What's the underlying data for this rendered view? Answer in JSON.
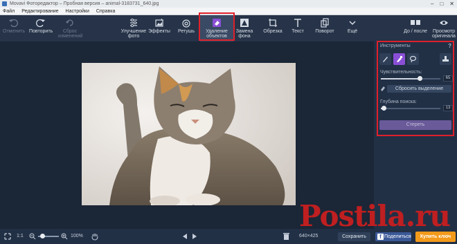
{
  "titlebar": {
    "title": "Movavi Фоторедактор – Пробная версия – animal-3183731_640.jpg",
    "controls": [
      "–",
      "□",
      "✕"
    ]
  },
  "menu": [
    "Файл",
    "Редактирование",
    "Настройки",
    "Справка"
  ],
  "toolbar": {
    "undo": "Отменить",
    "redo": "Повторить",
    "reset_line1": "Сброс",
    "reset_line2": "изменений",
    "enhance_line1": "Улучшение",
    "enhance_line2": "фото",
    "effects": "Эффекты",
    "retouch": "Ретушь",
    "remove_line1": "Удаление",
    "remove_line2": "объектов",
    "bg_line1": "Замена",
    "bg_line2": "фона",
    "crop": "Обрезка",
    "text": "Текст",
    "rotate": "Поворот",
    "more": "Ещё",
    "before_after": "До / после",
    "view_line1": "Просмотр",
    "view_line2": "оригинала"
  },
  "panel": {
    "heading": "Инструменты",
    "help": "?",
    "sensitivity_label": "Чувствительность:",
    "sensitivity_value": "65",
    "reset_selection": "Сбросить выделение",
    "depth_label": "Глубина поиска:",
    "depth_value": "13",
    "apply": "Стереть"
  },
  "status": {
    "fit": "1:1",
    "zoom": "100%",
    "size": "640×425",
    "save": "Сохранить",
    "share": "Поделиться",
    "share_icon": "f",
    "buy": "Купить ключ"
  },
  "watermark": {
    "text": "Postila.ru"
  },
  "colors": {
    "accent": "#8a4fd6",
    "highlight": "#e0202a",
    "buy": "#f39a1b",
    "facebook": "#3b5998"
  }
}
